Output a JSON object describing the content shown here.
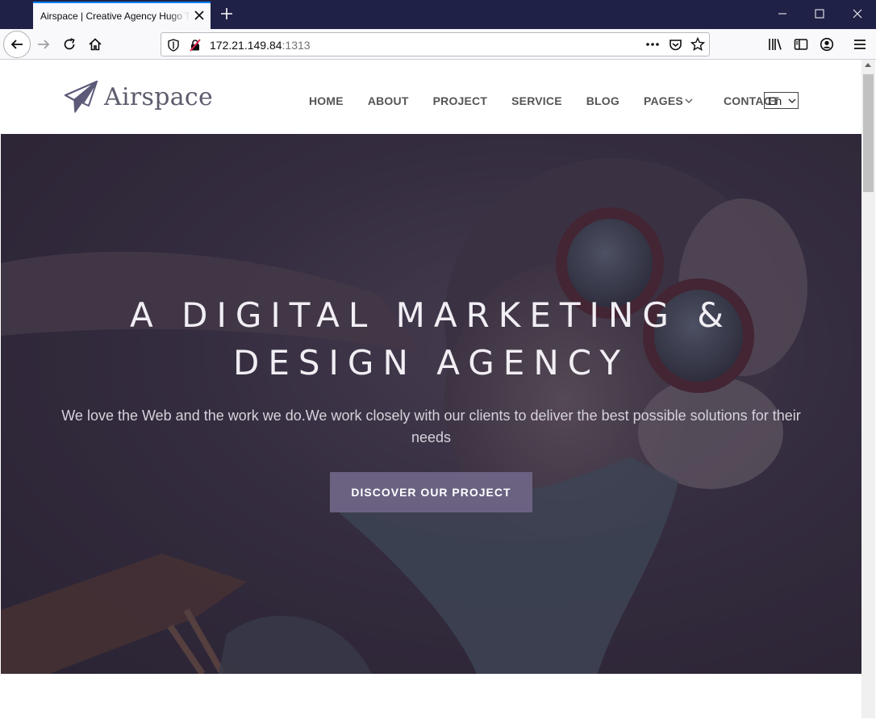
{
  "browser": {
    "tab_title": "Airspace | Creative Agency Hugo Template",
    "url_host": "172.21.149.84",
    "url_port": ":1313"
  },
  "site": {
    "logo_text": "Airspace",
    "menu": [
      "HOME",
      "ABOUT",
      "PROJECT",
      "SERVICE",
      "BLOG",
      "PAGES",
      "CONTACT"
    ],
    "language": "En"
  },
  "hero": {
    "title_line1": "A DIGITAL MARKETING &",
    "title_line2": "DESIGN AGENCY",
    "subtitle": "We love the Web and the work we do.We work closely with our clients to deliver the best possible solutions for their needs",
    "cta_label": "DISCOVER OUR PROJECT"
  },
  "colors": {
    "accent": "#6b6282",
    "titlebar": "#1f2146"
  }
}
